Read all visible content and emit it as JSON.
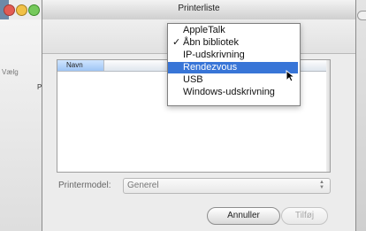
{
  "window": {
    "title": "Printerliste"
  },
  "background": {
    "left_label": "Vælg",
    "left_char": "P"
  },
  "list": {
    "column_header": "Navn"
  },
  "printer_model": {
    "label": "Printermodel:",
    "value": "Generel"
  },
  "buttons": {
    "cancel": "Annuller",
    "add": "Tilføj"
  },
  "menu": {
    "items": [
      {
        "label": "AppleTalk",
        "checked": false,
        "selected": false
      },
      {
        "label": "Åbn bibliotek",
        "checked": true,
        "selected": false
      },
      {
        "label": "IP-udskrivning",
        "checked": false,
        "selected": false
      },
      {
        "label": "Rendezvous",
        "checked": false,
        "selected": true
      },
      {
        "label": "USB",
        "checked": false,
        "selected": false
      },
      {
        "label": "Windows-udskrivning",
        "checked": false,
        "selected": false
      }
    ],
    "checkmark": "✓"
  },
  "colors": {
    "selection": "#3875d7",
    "close": "#e25c54",
    "minimize": "#f1c146",
    "zoom": "#75c95b"
  }
}
